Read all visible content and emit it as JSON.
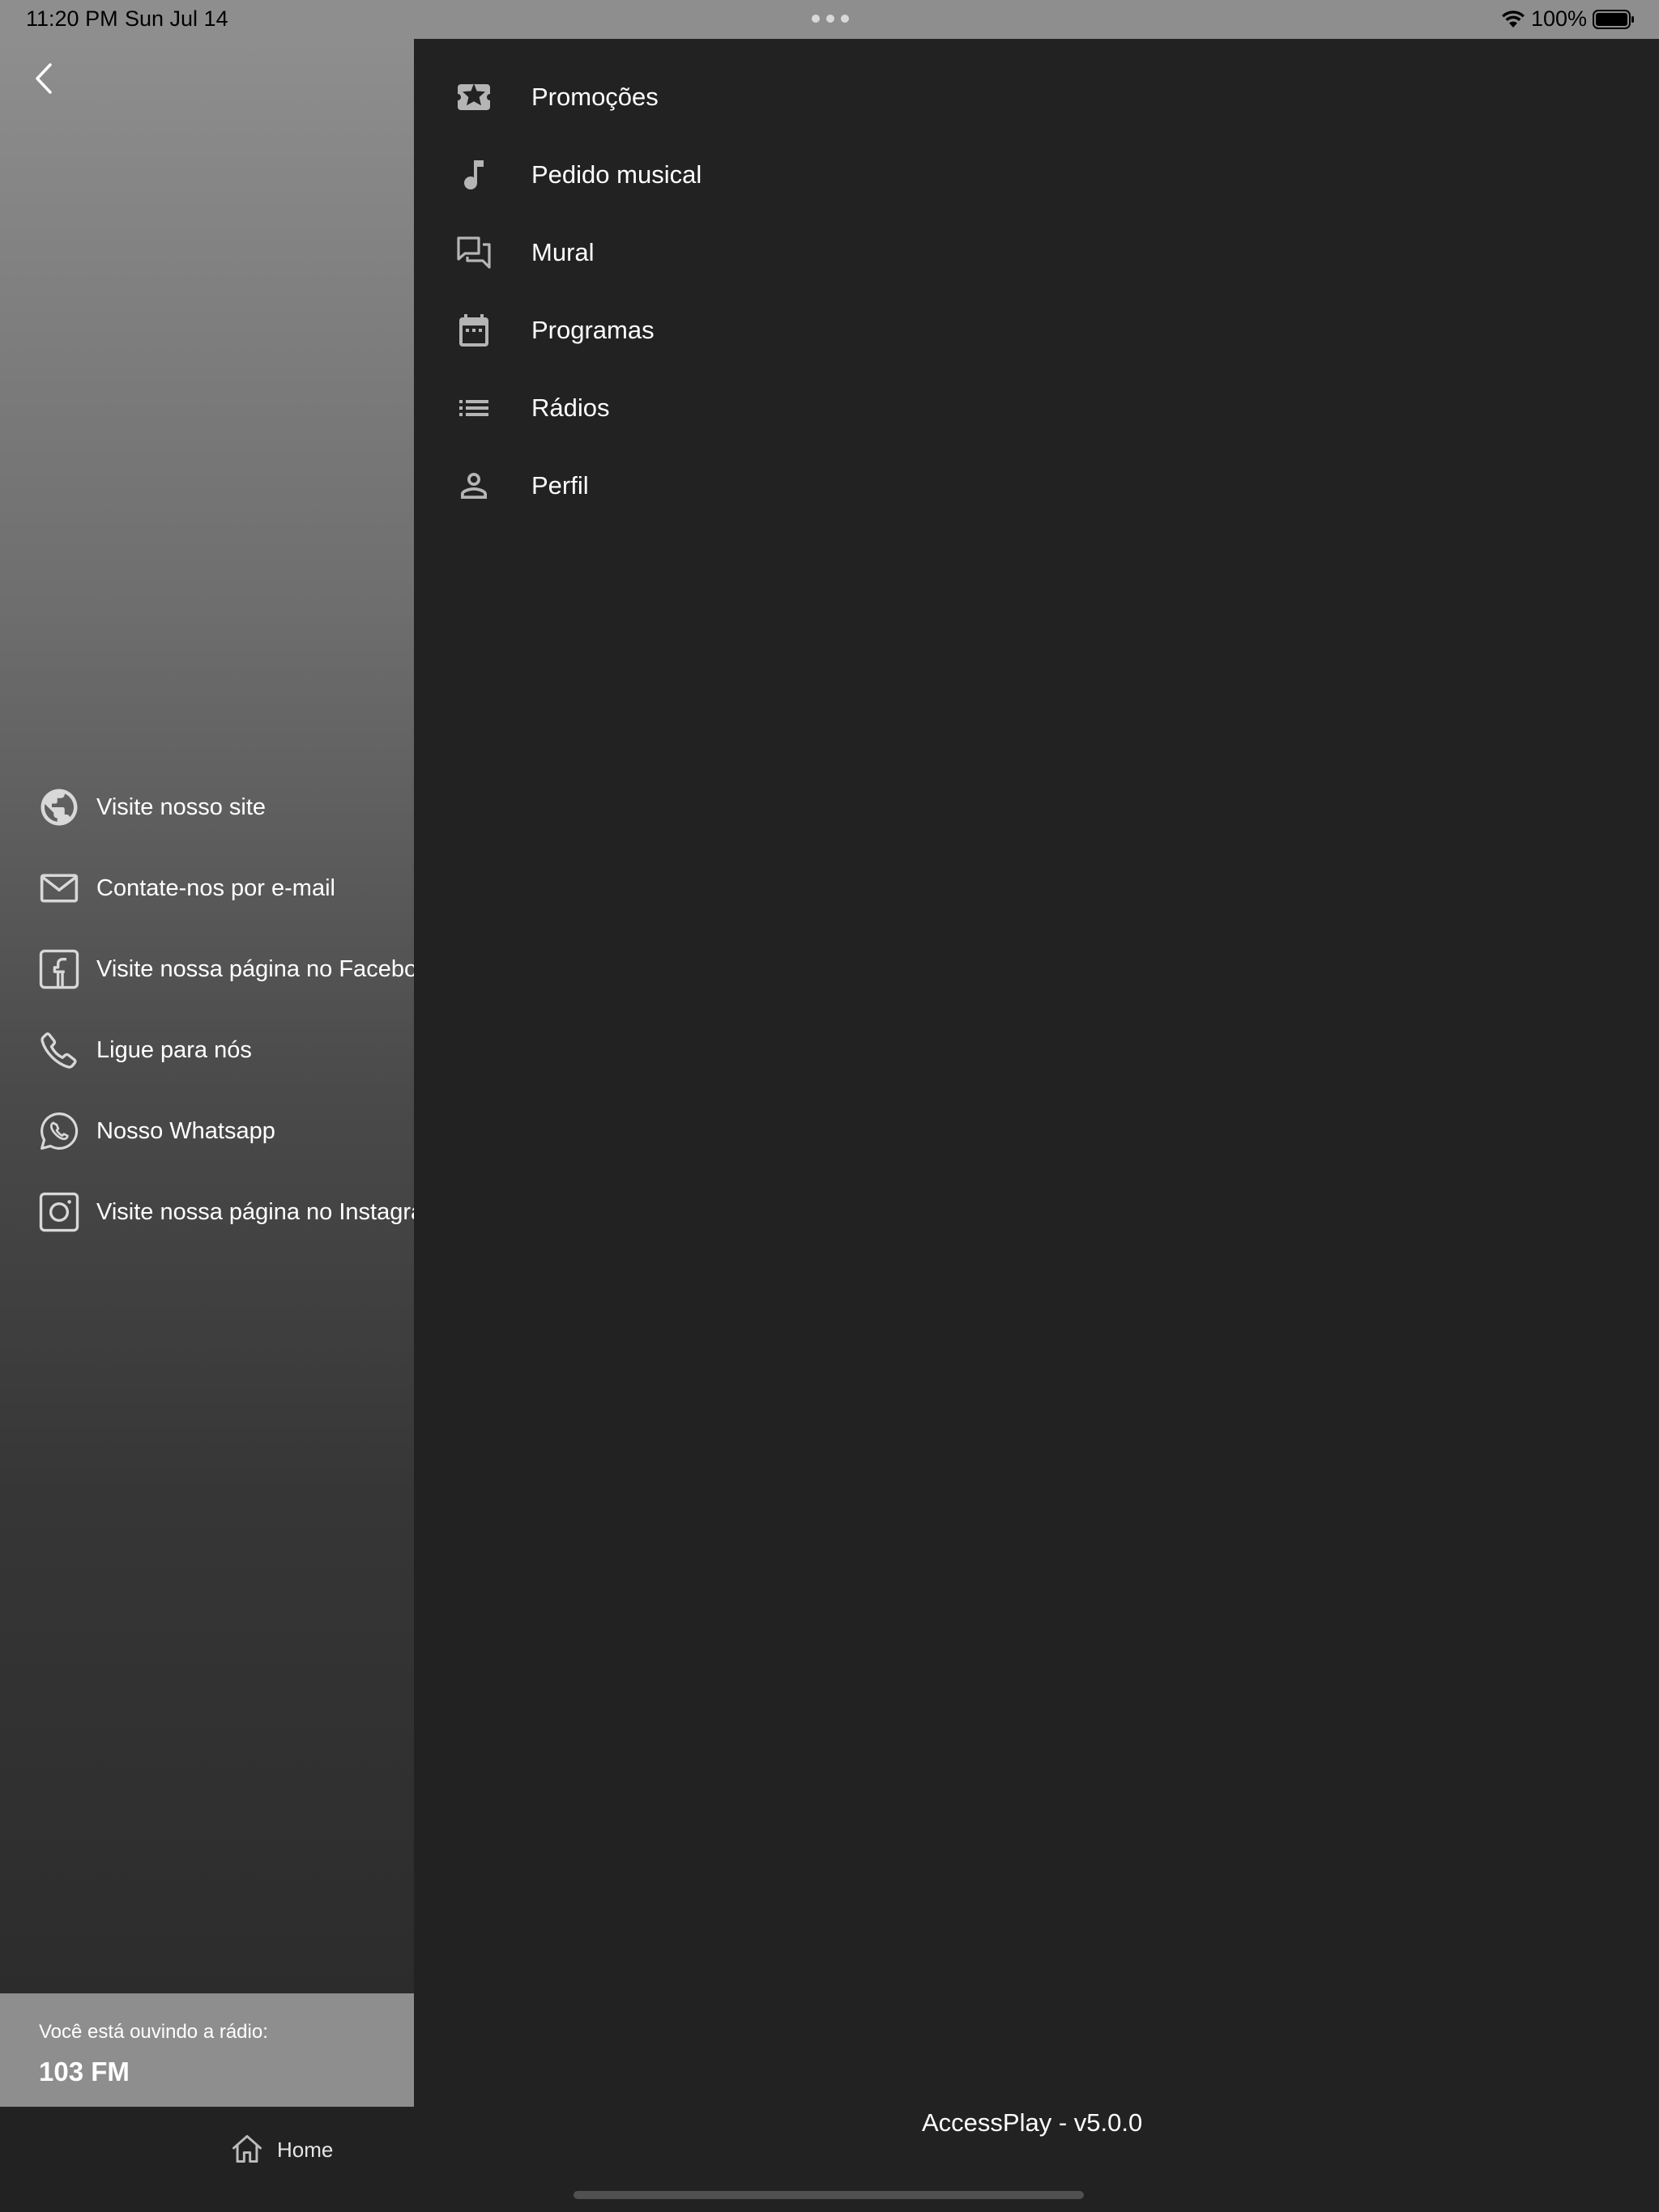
{
  "status_bar": {
    "time": "11:20 PM",
    "date": "Sun Jul 14",
    "battery": "100%"
  },
  "menu": {
    "items": [
      {
        "label": "Promoções",
        "icon": "ticket-star-icon"
      },
      {
        "label": "Pedido musical",
        "icon": "music-note-icon"
      },
      {
        "label": "Mural",
        "icon": "forum-icon"
      },
      {
        "label": "Programas",
        "icon": "calendar-icon"
      },
      {
        "label": "Rádios",
        "icon": "list-icon"
      },
      {
        "label": "Perfil",
        "icon": "person-icon"
      }
    ]
  },
  "social": {
    "items": [
      {
        "label": "Visite nosso site",
        "icon": "globe-icon"
      },
      {
        "label": "Contate-nos por e-mail",
        "icon": "mail-icon"
      },
      {
        "label": "Visite nossa página no Facebook",
        "icon": "facebook-icon"
      },
      {
        "label": "Ligue para nós",
        "icon": "phone-icon"
      },
      {
        "label": "Nosso Whatsapp",
        "icon": "whatsapp-icon"
      },
      {
        "label": "Visite nossa página no Instagram",
        "icon": "instagram-icon"
      }
    ]
  },
  "now_playing": {
    "caption": "Você está ouvindo a rádio:",
    "station": "103 FM"
  },
  "tab_bar": {
    "home_label": "Home"
  },
  "app_version": "AccessPlay - v5.0.0",
  "colors": {
    "drawer_bg": "#222222",
    "now_playing_bg": "#8e8e8e",
    "icon_gray": "#b5b5b5"
  }
}
